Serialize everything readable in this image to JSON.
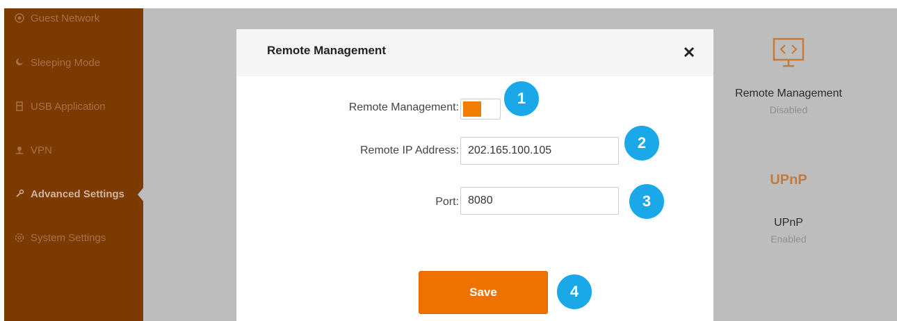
{
  "sidebar": {
    "items": [
      {
        "label": "Guest Network",
        "icon": "guest-network-icon"
      },
      {
        "label": "Sleeping Mode",
        "icon": "sleeping-mode-icon"
      },
      {
        "label": "USB Application",
        "icon": "usb-icon"
      },
      {
        "label": "VPN",
        "icon": "vpn-icon"
      },
      {
        "label": "Advanced Settings",
        "icon": "wrench-icon",
        "active": true
      },
      {
        "label": "System Settings",
        "icon": "gear-icon"
      }
    ]
  },
  "background_cards": [
    {
      "label": "Remote Management",
      "status": "Disabled",
      "icon": "monitor-code-icon"
    },
    {
      "label": "UPnP",
      "status": "Enabled",
      "icon": "upnp-icon",
      "icon_text": "UPnP"
    }
  ],
  "modal": {
    "title": "Remote Management",
    "close_icon": "close-icon",
    "fields": {
      "remote_management": {
        "label": "Remote Management:",
        "enabled": true
      },
      "remote_ip": {
        "label": "Remote IP Address:",
        "value": "202.165.100.105"
      },
      "port": {
        "label": "Port:",
        "value": "8080"
      }
    },
    "save_label": "Save"
  },
  "callouts": [
    "1",
    "2",
    "3",
    "4"
  ],
  "colors": {
    "accent": "#ef7200",
    "sidebar_bg": "#7b3a00",
    "overlay_bg": "#bdbdbd",
    "callout": "#1aa8e8"
  }
}
